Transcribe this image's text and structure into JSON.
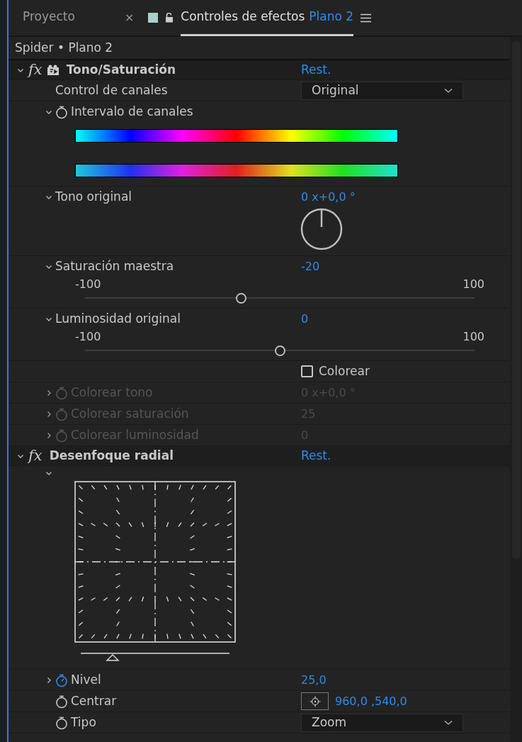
{
  "tabs": [
    {
      "label": "Proyecto",
      "selected": false,
      "close": "×"
    },
    {
      "label": "Controles de efectos",
      "suffix": "Plano 2",
      "selected": true
    }
  ],
  "breadcrumb": "Spider • Plano 2",
  "effects": [
    {
      "fx": "fx",
      "name": "Tono/Saturación",
      "reset": "Rest.",
      "expanded": true,
      "compat_icon": true,
      "properties": [
        {
          "kind": "dropdown",
          "label": "Control de canales",
          "value": "Original",
          "disabled": false
        },
        {
          "kind": "color_range",
          "label": "Intervalo de canales",
          "expanded": true,
          "stopwatch": false,
          "disabled": false
        },
        {
          "kind": "angle",
          "label": "Tono original",
          "value": "0 x+0,0 °",
          "expanded": true,
          "disabled": false
        },
        {
          "kind": "slider",
          "label": "Saturación maestra",
          "value": "-20",
          "min": "-100",
          "max": "100",
          "level": 0.4,
          "expanded": true,
          "disabled": false
        },
        {
          "kind": "slider",
          "label": "Luminosidad original",
          "value": "0",
          "min": "-100",
          "max": "100",
          "level": 0.5,
          "expanded": true,
          "disabled": false
        },
        {
          "kind": "checkbox",
          "label": "Colorear",
          "checked": false
        },
        {
          "kind": "value",
          "label": "Colorear tono",
          "value": "0 x+0,0 °",
          "expanded": false,
          "stopwatch": false,
          "disabled": true
        },
        {
          "kind": "value",
          "label": "Colorear saturación",
          "value": "25",
          "expanded": false,
          "stopwatch": false,
          "disabled": true
        },
        {
          "kind": "value",
          "label": "Colorear luminosidad",
          "value": "0",
          "expanded": false,
          "stopwatch": false,
          "disabled": true
        }
      ]
    },
    {
      "fx": "fx",
      "name": "Desenfoque radial",
      "reset": "Rest.",
      "expanded": true,
      "properties": [
        {
          "kind": "preview",
          "expanded": true
        },
        {
          "kind": "value",
          "label": "Nivel",
          "value": "25,0",
          "expanded": false,
          "stopwatch": true,
          "disabled": false
        },
        {
          "kind": "point",
          "label": "Centrar",
          "value": "960,0 ,540,0",
          "stopwatch": false,
          "disabled": false
        },
        {
          "kind": "dropdown_sw",
          "label": "Tipo",
          "value": "Zoom",
          "stopwatch": false,
          "disabled": false
        }
      ]
    }
  ]
}
